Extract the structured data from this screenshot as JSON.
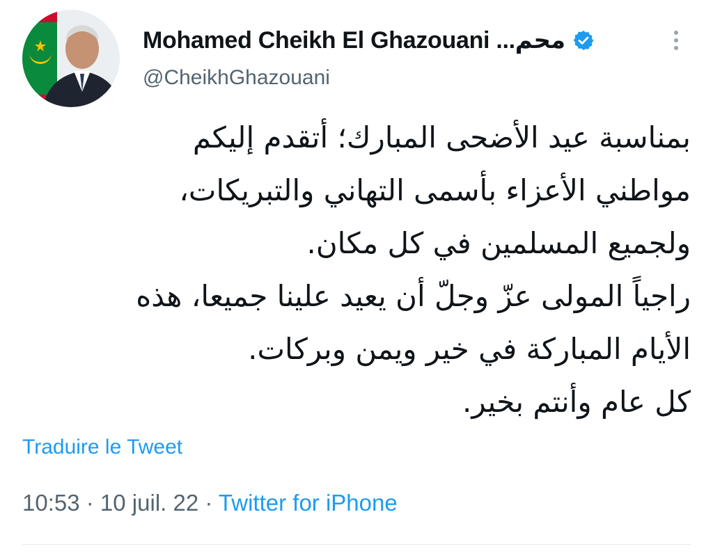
{
  "author": {
    "display_name": "Mohamed Cheikh El Ghazouani ...محم",
    "handle": "@CheikhGhazouani",
    "verified": true,
    "avatar_icon": "profile-photo-with-flag"
  },
  "tweet": {
    "lines": [
      "بمناسبة عيد الأضحى المبارك؛ أتقدم إليكم",
      "مواطني الأعزاء بأسمى التهاني والتبريكات،",
      "ولجميع المسلمين في كل مكان.",
      "راجياً المولى عزّ وجلّ أن يعيد علينا جميعا، هذه",
      "الأيام المباركة في خير ويمن وبركات.",
      "كل عام وأنتم بخير."
    ],
    "translate_label": "Traduire le Tweet",
    "time": "10:53",
    "separator": " · ",
    "date": "10 juil. 22",
    "source": "Twitter for iPhone"
  },
  "colors": {
    "accent": "#1d9bf0",
    "secondary_text": "#536471",
    "primary_text": "#0f1419"
  },
  "icons": {
    "verified": "verified-badge-icon",
    "more": "more-vertical-icon"
  }
}
